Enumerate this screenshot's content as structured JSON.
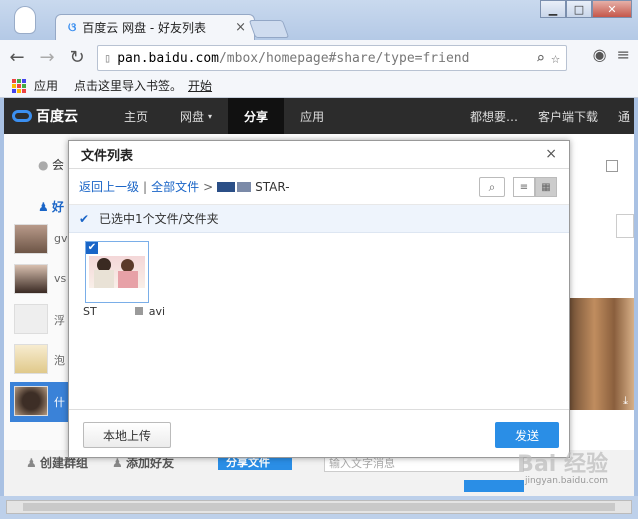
{
  "browser": {
    "tab_title": "百度云 网盘 - 好友列表",
    "tab_close": "×",
    "url_host": "pan.baidu.com",
    "url_path": "/mbox/homepage#share/type=friend",
    "window_buttons": [
      "▁",
      "□",
      "✕"
    ],
    "bookmarks": {
      "apps_label": "应用",
      "import_hint": "点击这里导入书签。",
      "start_label": "开始"
    }
  },
  "baidu_nav": {
    "logo_text": "百度云",
    "items": [
      "主页",
      "网盘",
      "分享",
      "应用"
    ],
    "active_index": 2,
    "right": {
      "more": "都想要…",
      "client": "客户端下载",
      "notify": "通"
    }
  },
  "background": {
    "left_labels": {
      "top1": "会",
      "top2": "好"
    },
    "friends": [
      "gv",
      "vs",
      "浮",
      "泡",
      "什"
    ],
    "bottom": {
      "create_group": "创建群组",
      "add_friend": "添加好友",
      "share_btn": "分享文件",
      "input_placeholder": "输入文字消息"
    }
  },
  "dialog": {
    "title": "文件列表",
    "close": "×",
    "breadcrumb": {
      "back": "返回上一级",
      "all_files": "全部文件",
      "current_suffix": "STAR-"
    },
    "selection_text": "已选中1个文件/文件夹",
    "file": {
      "name_prefix": "ST",
      "name_suffix": "avi"
    },
    "upload_button": "本地上传",
    "send_button": "发送"
  },
  "watermark": {
    "text": "Bai 经验",
    "url": "jingyan.baidu.com"
  },
  "colors": {
    "accent": "#2a8ee6",
    "link": "#1a65c7",
    "nav_bg": "#2c2c2c"
  }
}
